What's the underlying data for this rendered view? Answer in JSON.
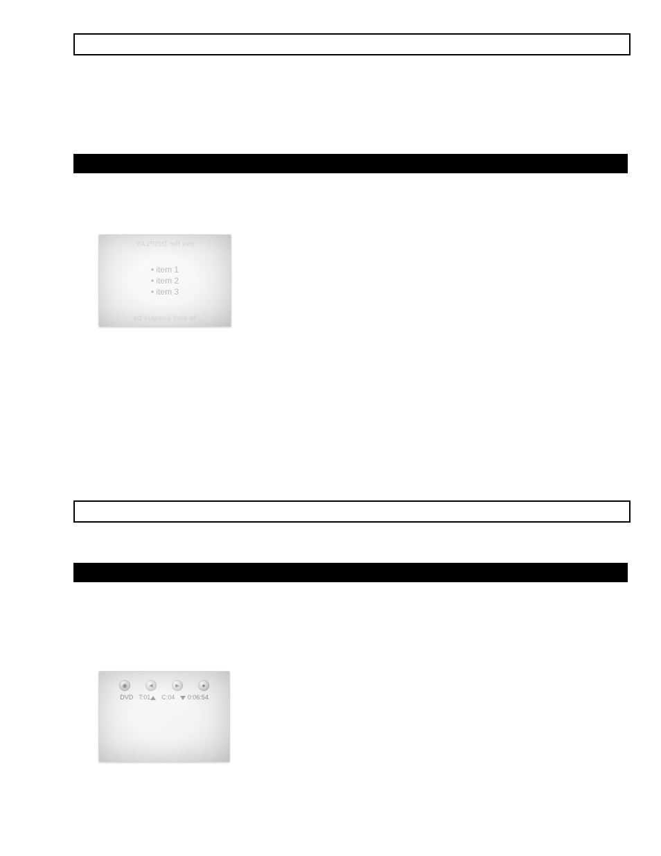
{
  "figure1": {
    "items": [
      "item 1",
      "item 2",
      "item 3"
    ],
    "ghost_top": "ess the DISPLAY",
    "ghost_bottom": "ed elapsed time of"
  },
  "figure2": {
    "labels": {
      "media": "DVD",
      "title": "T:01",
      "chapter": "C:04",
      "time": "0:06:54"
    },
    "icons": [
      "disc-icon",
      "rewind-icon",
      "ffwd-icon",
      "stop-icon"
    ],
    "ghost": ""
  }
}
